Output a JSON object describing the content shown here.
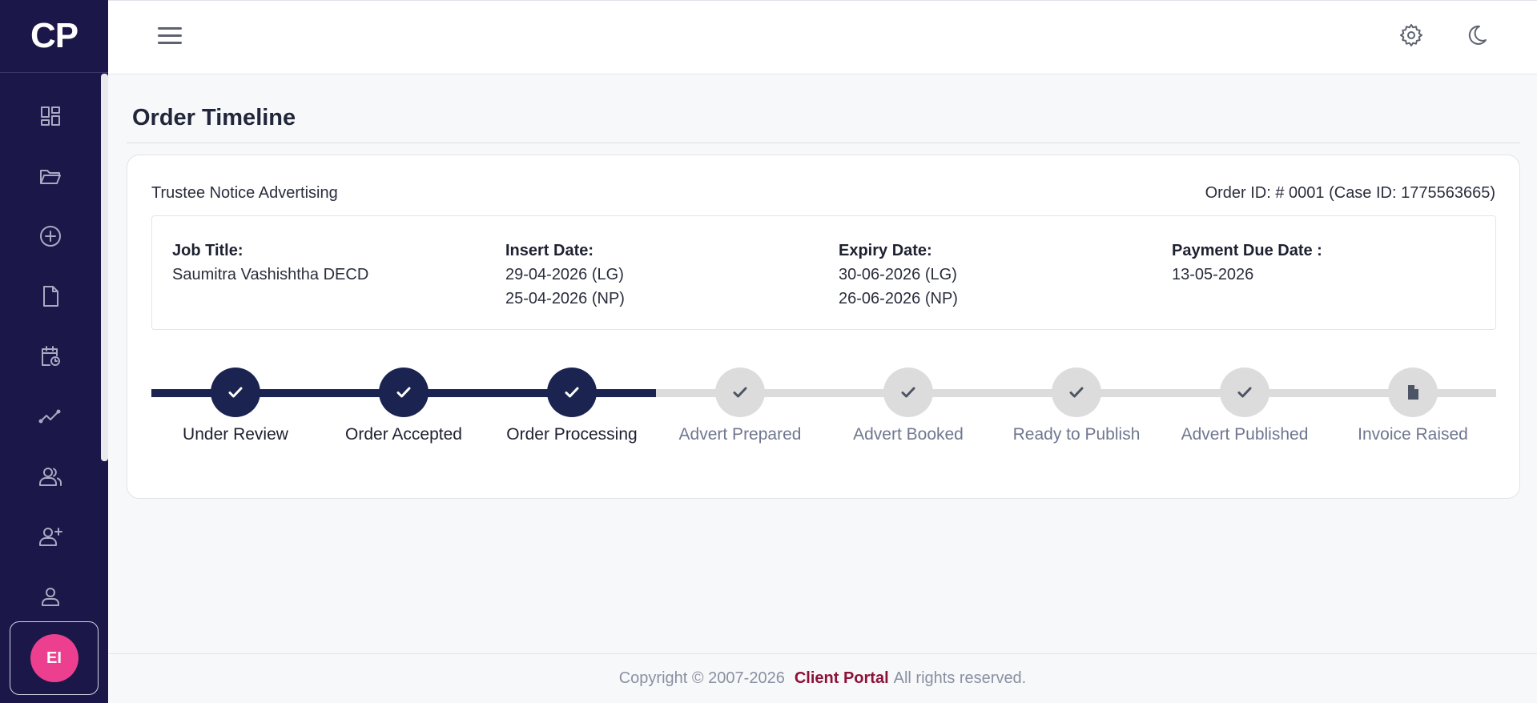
{
  "sidebar": {
    "logo": "CP",
    "nav": [
      {
        "name": "dashboard-icon"
      },
      {
        "name": "folder-icon"
      },
      {
        "name": "add-circle-icon"
      },
      {
        "name": "document-icon"
      },
      {
        "name": "calendar-clock-icon"
      },
      {
        "name": "trend-icon"
      },
      {
        "name": "users-icon"
      },
      {
        "name": "user-add-icon"
      },
      {
        "name": "user-icon"
      }
    ],
    "avatar_initials": "EI",
    "avatar_color": "#ec3f8f"
  },
  "header": {
    "menu_icon": "hamburger-icon",
    "settings_icon": "gear-icon",
    "theme_icon": "moon-icon"
  },
  "page": {
    "title": "Order Timeline"
  },
  "order": {
    "service": "Trustee Notice Advertising",
    "order_ref": "Order ID: # 0001 (Case ID: 1775563665)",
    "job_title_label": "Job Title:",
    "job_title": "Saumitra Vashishtha DECD",
    "insert_date_label": "Insert Date:",
    "insert_date_lg": "29-04-2026 (LG)",
    "insert_date_np": "25-04-2026 (NP)",
    "expiry_date_label": "Expiry Date:",
    "expiry_date_lg": "30-06-2026 (LG)",
    "expiry_date_np": "26-06-2026 (NP)",
    "payment_due_label": "Payment Due Date :",
    "payment_due": "13-05-2026"
  },
  "timeline": {
    "steps": [
      {
        "label": "Under Review",
        "done": true
      },
      {
        "label": "Order Accepted",
        "done": true
      },
      {
        "label": "Order Processing",
        "done": true
      },
      {
        "label": "Advert Prepared",
        "done": false
      },
      {
        "label": "Advert Booked",
        "done": false
      },
      {
        "label": "Ready to Publish",
        "done": false
      },
      {
        "label": "Advert Published",
        "done": false
      },
      {
        "label": "Invoice Raised",
        "done": false
      }
    ],
    "completed_count": 3,
    "done_color": "#1b2351",
    "todo_color": "#dcdcdc"
  },
  "footer": {
    "copyright": "Copyright © 2007-2026",
    "brand": "Client Portal",
    "rights": "All rights reserved.",
    "brand_color": "#8d1238"
  }
}
